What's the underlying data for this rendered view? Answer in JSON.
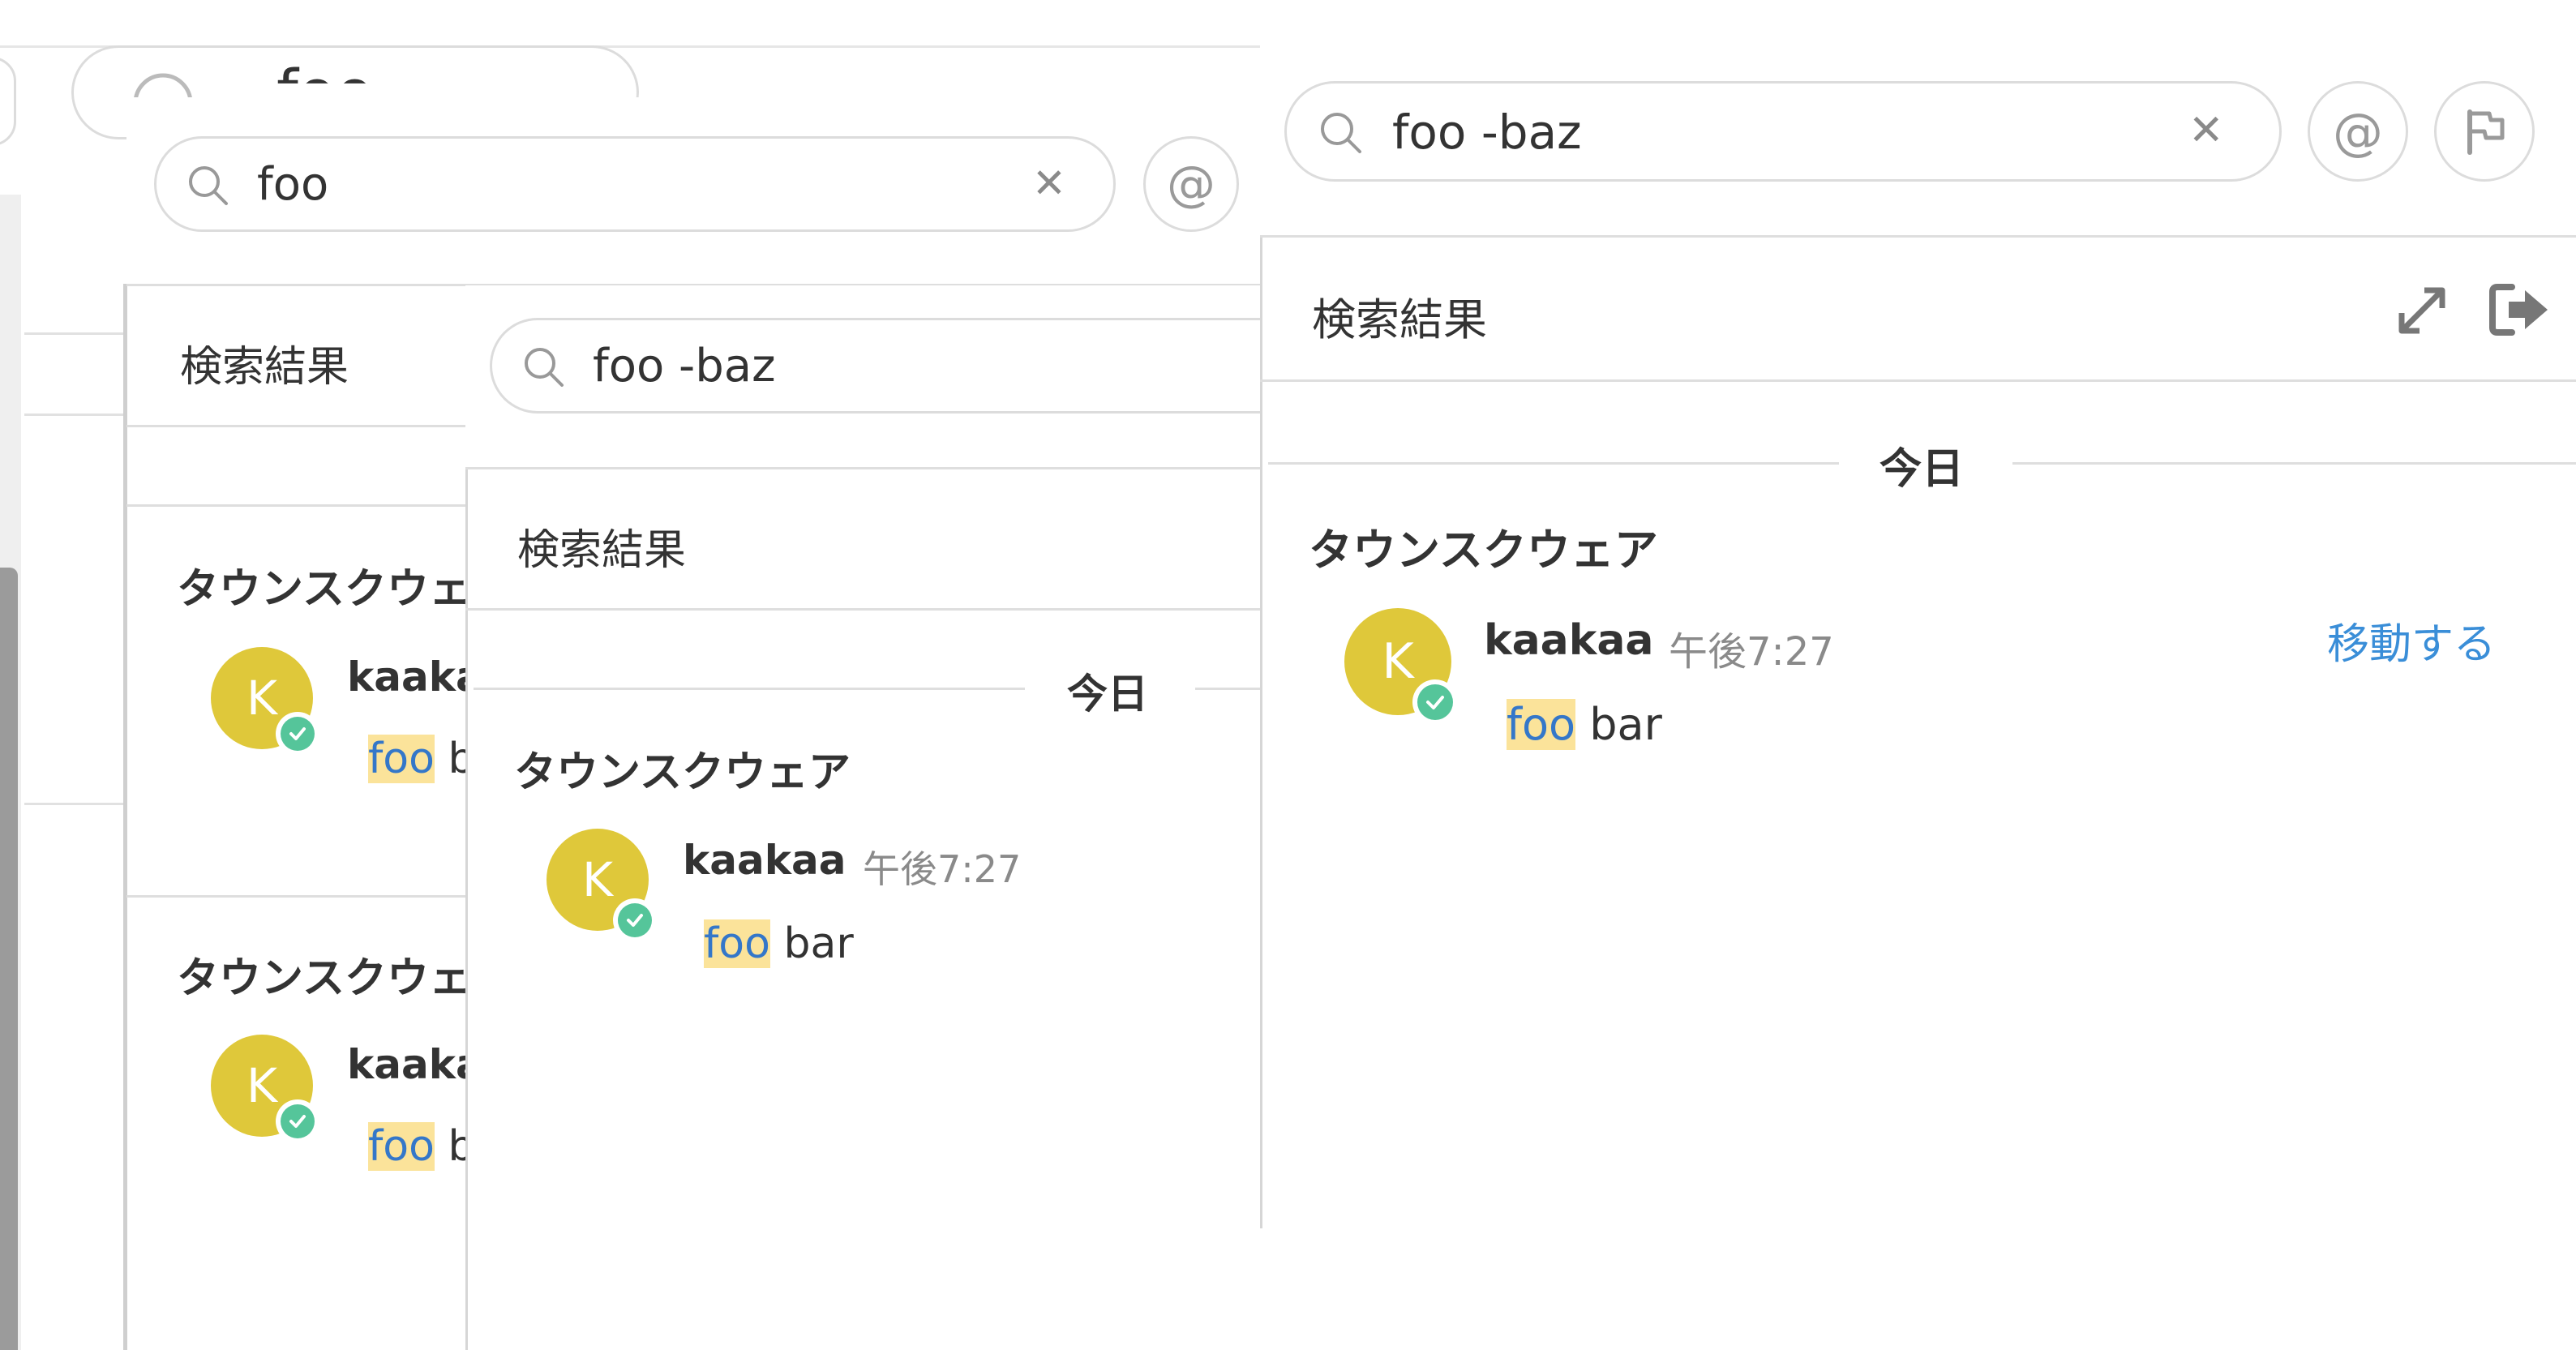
{
  "search": {
    "back_query": "foo",
    "layer1_query": "foo",
    "layer2_query": "foo -baz",
    "layer3_query": "foo -baz",
    "clear_glyph": "✕",
    "mention_glyph": "@"
  },
  "results": {
    "title": "検索結果",
    "date_label": "今日",
    "team_name": "タウンスクウェア",
    "team_name_cut": "タウンスクウェ",
    "avatar_letter": "K",
    "user": "kaakaa",
    "user_cut": "kaaka",
    "user_cut_b": "kaaka",
    "time": "午後7:27",
    "highlight": "foo",
    "rest": "bar",
    "rest_cut": "b",
    "jump_label": "移動する"
  },
  "icons": [
    "search-icon",
    "close-icon",
    "at-mention-icon",
    "flag-icon",
    "expand-icon",
    "collapse-sidebar-icon",
    "check-icon"
  ],
  "colors": {
    "highlight_bg": "#fbe39a",
    "highlight_text": "#3477c9",
    "avatar": "#dfc83a",
    "status_online": "#55c59a",
    "jump_link": "#3a8ed8"
  }
}
